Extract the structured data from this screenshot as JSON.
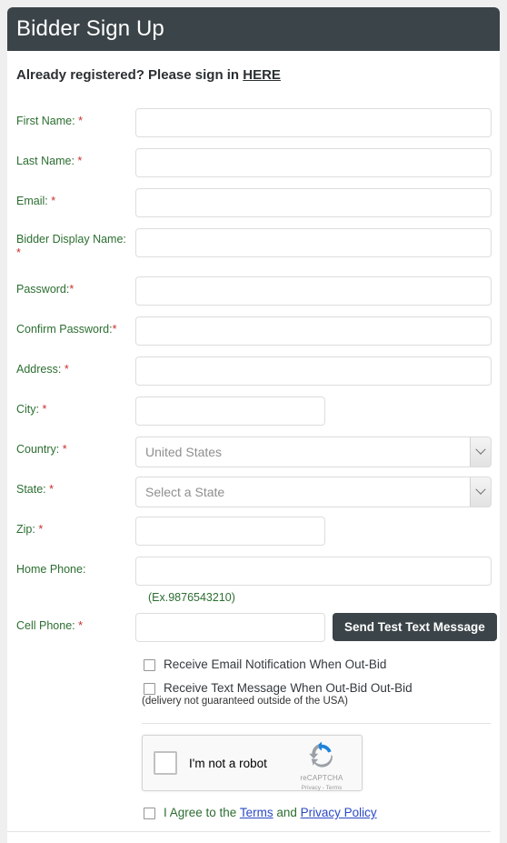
{
  "page": {
    "title": "Bidder Sign Up",
    "signin_prompt": "Already registered? Please sign in ",
    "signin_link": "HERE"
  },
  "colors": {
    "header_bg": "#3b4448",
    "label_green": "#2c6e31",
    "required_red": "#c9302c",
    "link_blue": "#2a49c6",
    "page_bg": "#efefef"
  },
  "form": {
    "fields": [
      {
        "label": "First Name:",
        "required": "*",
        "value": "",
        "placeholder": ""
      },
      {
        "label": "Last Name:",
        "required": "*",
        "value": "",
        "placeholder": ""
      },
      {
        "label": "Email:",
        "required": "*",
        "value": "",
        "placeholder": ""
      },
      {
        "label": "Bidder Display Name:",
        "required": "*",
        "value": "",
        "placeholder": ""
      },
      {
        "label": "Password:",
        "required": "*",
        "value": "",
        "placeholder": ""
      },
      {
        "label": "Confirm Password:",
        "required": "*",
        "value": "",
        "placeholder": ""
      },
      {
        "label": "Address:",
        "required": "*",
        "value": "",
        "placeholder": ""
      },
      {
        "label": "City:",
        "required": "*",
        "value": "",
        "placeholder": ""
      },
      {
        "label": "Country:",
        "required": "*",
        "value": "United States",
        "placeholder": ""
      },
      {
        "label": "State:",
        "required": "*",
        "value": "Select a State",
        "placeholder": ""
      },
      {
        "label": "Zip:",
        "required": "*",
        "value": "",
        "placeholder": ""
      },
      {
        "label": "Home Phone:",
        "required": "",
        "value": "",
        "placeholder": ""
      },
      {
        "label": "Cell Phone:",
        "required": "*",
        "value": "",
        "placeholder": ""
      }
    ],
    "phone_hint": "(Ex.9876543210)",
    "send_test_button": "Send Test Text Message",
    "country_selected": "United States",
    "state_selected": "Select a State"
  },
  "options": {
    "email_notification": "Receive Email Notification When Out-Bid",
    "text_notification": "Receive Text Message When Out-Bid Out-Bid",
    "delivery_note": "(delivery not guaranteed outside of the USA)"
  },
  "recaptcha": {
    "label": "I'm not a robot",
    "brand": "reCAPTCHA",
    "legal": "Privacy - Terms"
  },
  "agreement": {
    "prefix": "I Agree to the ",
    "terms": "Terms",
    "middle": " and ",
    "privacy": "Privacy Policy"
  }
}
